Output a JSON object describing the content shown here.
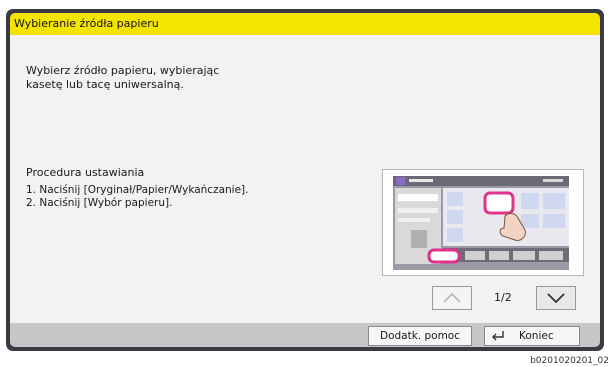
{
  "title": "Wybieranie źródła papieru",
  "description": "Wybierz źródło papieru, wybierając\nkasetę lub tacę uniwersalną.",
  "procedure": {
    "title": "Procedura ustawiania",
    "steps": [
      "1. Naciśnij [Oryginał/Papier/Wykańczanie].",
      "2. Naciśnij [Wybór papieru]."
    ]
  },
  "pager": {
    "indicator": "1/2",
    "up_icon": "chevron-up-icon",
    "down_icon": "chevron-down-icon"
  },
  "buttons": {
    "help": "Dodatk. pomoc",
    "end": "Koniec",
    "end_icon": "return-arrow-icon"
  },
  "reference": "b0201020201_02",
  "colors": {
    "title_bar": "#f5e400",
    "frame": "#3a3a44",
    "highlight": "#e0338a"
  }
}
